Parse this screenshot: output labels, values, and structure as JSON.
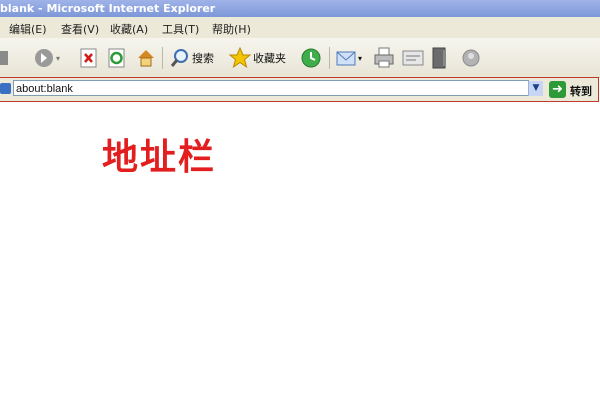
{
  "window": {
    "title": "blank - Microsoft Internet Explorer"
  },
  "menu": [
    "编辑(E)",
    "查看(V)",
    "收藏(A)",
    "工具(T)",
    "帮助(H)"
  ],
  "toolbar": {
    "search_label": "搜索",
    "favorites_label": "收藏夹",
    "icons": [
      "back-icon",
      "forward-icon",
      "stop-icon",
      "refresh-icon",
      "home-icon",
      "search-icon",
      "favorites-icon",
      "history-icon",
      "mail-icon",
      "print-icon",
      "edit-icon",
      "discuss-icon",
      "messenger-icon"
    ]
  },
  "address": {
    "value": "about:blank",
    "go_label": "转到"
  },
  "annotation": {
    "text": "地址栏"
  },
  "colors": {
    "annotation": "#e31e1e",
    "highlight_border": "#c0392b",
    "go_green": "#2e9a37"
  }
}
